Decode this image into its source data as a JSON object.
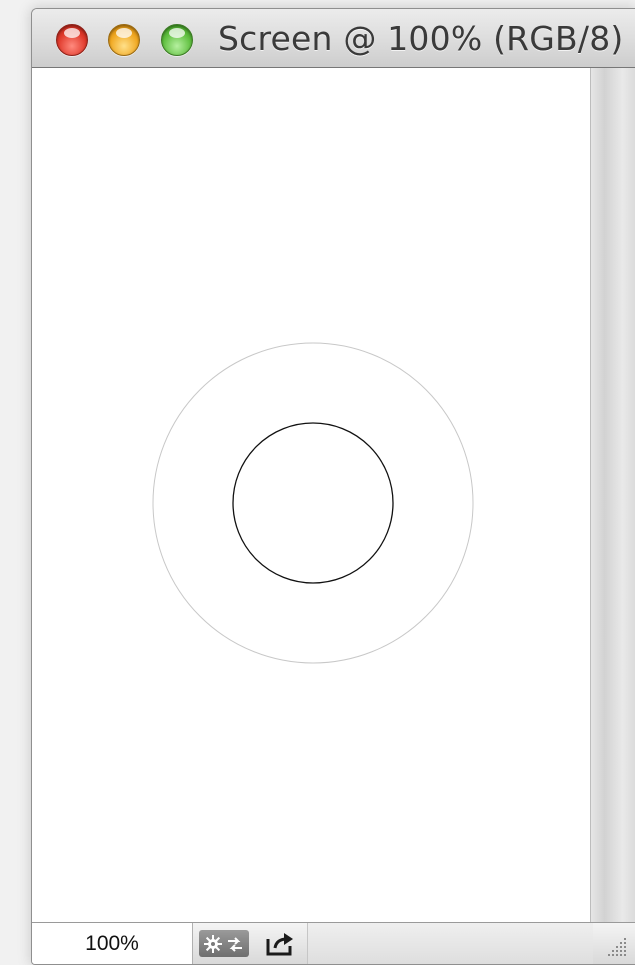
{
  "window": {
    "title": "Screen @ 100% (RGB/8)"
  },
  "traffic_lights": {
    "close": "close-button",
    "minimize": "minimize-button",
    "zoom": "zoom-button"
  },
  "status_bar": {
    "zoom_level": "100%",
    "info_icon": "gear-arrows-icon",
    "share_icon": "share-icon"
  },
  "canvas": {
    "content": "concentric-circles",
    "outer_circle_color": "#c8c8c8",
    "inner_circle_color": "#111111"
  }
}
